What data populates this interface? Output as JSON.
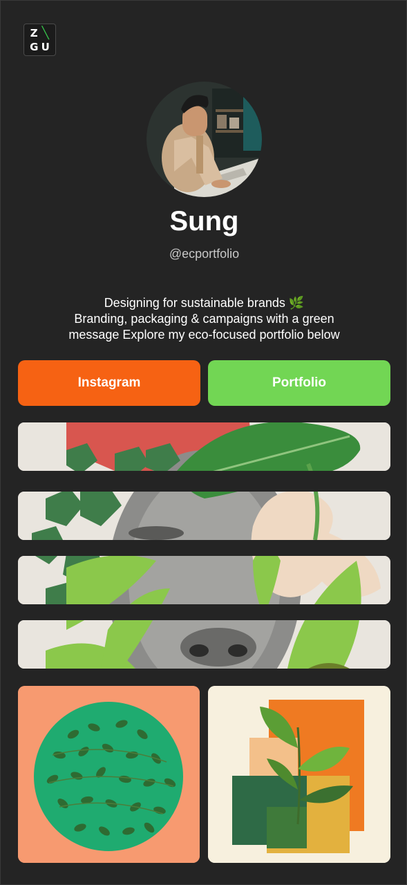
{
  "logo": {
    "letters": [
      "Z",
      "G",
      "U"
    ]
  },
  "profile": {
    "name": "Sung",
    "handle": "@ecportfolio",
    "bio_line1": "Designing for sustainable brands",
    "bio_emoji": "🌿",
    "bio_line2": "Branding, packaging & campaigns with a green",
    "bio_line3": "message Explore my eco-focused portfolio below"
  },
  "buttons": {
    "instagram_label": "Instagram",
    "portfolio_label": "Portfolio"
  },
  "colors": {
    "background": "#242424",
    "instagram": "#f66213",
    "portfolio": "#72d654",
    "logo_accent": "#36c24a"
  },
  "icons": [
    "zgu-logo-icon"
  ]
}
